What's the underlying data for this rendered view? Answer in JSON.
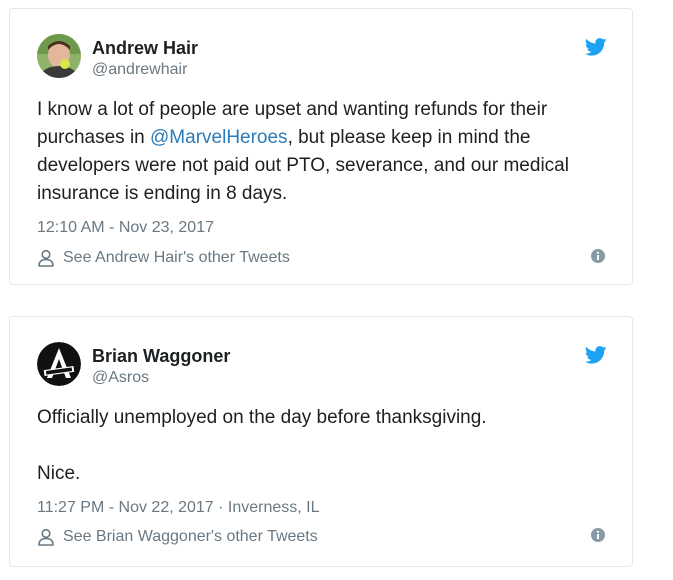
{
  "tweets": [
    {
      "name": "Andrew Hair",
      "handle": "@andrewhair",
      "text_before": "I know a lot of people are upset and wanting refunds for their purchases in ",
      "mention": "@MarvelHeroes",
      "text_after": ", but please keep in mind the developers were not paid out PTO, severance, and our medical insurance is ending in 8 days.",
      "timestamp": "12:10 AM - Nov 23, 2017",
      "see_others": "See Andrew Hair's other Tweets"
    },
    {
      "name": "Brian Waggoner",
      "handle": "@Asros",
      "line1": "Officially unemployed on the day before thanksgiving.",
      "line2": "Nice.",
      "timestamp": "11:27 PM - Nov 22, 2017",
      "location_sep": " · ",
      "location": "Inverness, IL",
      "see_others": "See Brian Waggoner's other Tweets"
    }
  ],
  "colors": {
    "twitter_blue": "#1da1f2",
    "link": "#2b7bb9",
    "muted": "#697882",
    "text": "#1c2022",
    "border": "#e1e8ed"
  }
}
